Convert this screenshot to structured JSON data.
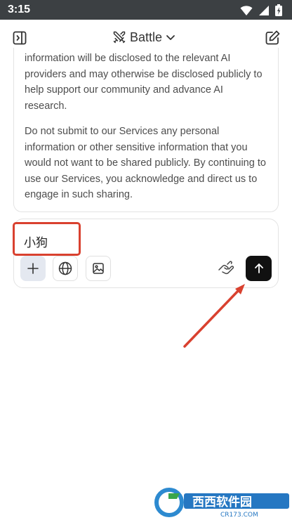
{
  "status_bar": {
    "time": "3:15"
  },
  "header": {
    "mode_label": "Battle"
  },
  "notice": {
    "paragraph_1": "information will be disclosed to the relevant AI providers and may otherwise be disclosed publicly to help support our community and advance AI research.",
    "paragraph_2": "Do not submit to our Services any personal information or other sensitive information that you would not want to be shared publicly. By continuing to use our Services, you acknowledge and direct us to engage in such sharing."
  },
  "composer": {
    "input_value": "小狗"
  },
  "watermark": {
    "text": "西西软件园",
    "url_text": "CR173.COM"
  },
  "colors": {
    "status_bar": "#3c4043",
    "annotation": "#d9412f",
    "send_button": "#111111",
    "add_button": "#e4e8f0"
  },
  "icons": [
    "sidebar-toggle-icon",
    "crossed-swords-icon",
    "chevron-down-icon",
    "new-chat-icon",
    "plus-icon",
    "globe-icon",
    "image-icon",
    "hand-icon",
    "arrow-up-icon"
  ]
}
